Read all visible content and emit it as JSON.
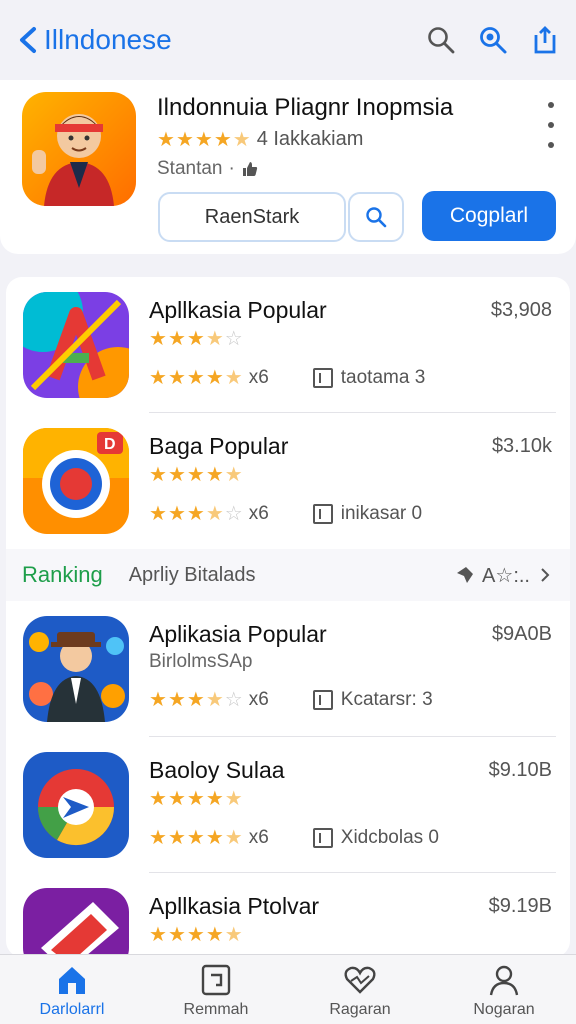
{
  "nav": {
    "back_label": "Illndonese",
    "icons": [
      "search-icon",
      "zoom-icon",
      "share-icon"
    ]
  },
  "header": {
    "title": "Ilndonnuia Pliagnr Inopmsia",
    "rating_stars": 4.5,
    "rating_text": "4 Iakkakiam",
    "subtitle": "Stantan",
    "outline_button": "RaenStark",
    "primary_button": "Cogplarl"
  },
  "apps": [
    {
      "name": "Apllkasia Popular",
      "price": "$3,908",
      "stars_primary": 3.5,
      "stars_meta": 4.5,
      "count": "x6",
      "category": "taotama 3"
    },
    {
      "name": "Baga Popular",
      "price": "$3.10k",
      "stars_primary": 4.5,
      "stars_meta": 3.5,
      "count": "x6",
      "category": "inikasar 0"
    }
  ],
  "ranking": {
    "title": "Ranking",
    "subtitle": "Aprliy Bitalads",
    "right": "A☆:.."
  },
  "apps2": [
    {
      "name": "Aplikasia Popular",
      "price": "$9A0B",
      "sub": "BirlolmsSAp",
      "stars_meta": 3.5,
      "count": "x6",
      "category": "Kcatarsr: 3"
    },
    {
      "name": "Baoloy Sulaa",
      "price": "$9.10B",
      "stars_primary": 4.5,
      "stars_meta": 4.5,
      "count": "x6",
      "category": "Xidcbolas 0"
    },
    {
      "name": "Apllkasia Ptolvar",
      "price": "$9.19B",
      "stars_primary": 4.5
    }
  ],
  "tabs": [
    {
      "label": "Darlolarrl",
      "icon": "home-icon",
      "active": true
    },
    {
      "label": "Remmah",
      "icon": "apps-icon",
      "active": false
    },
    {
      "label": "Ragaran",
      "icon": "heart-icon",
      "active": false
    },
    {
      "label": "Nogaran",
      "icon": "person-icon",
      "active": false
    }
  ],
  "colors": {
    "accent": "#1a73e8",
    "star": "#f5a623",
    "ranking": "#1e9e4a"
  }
}
